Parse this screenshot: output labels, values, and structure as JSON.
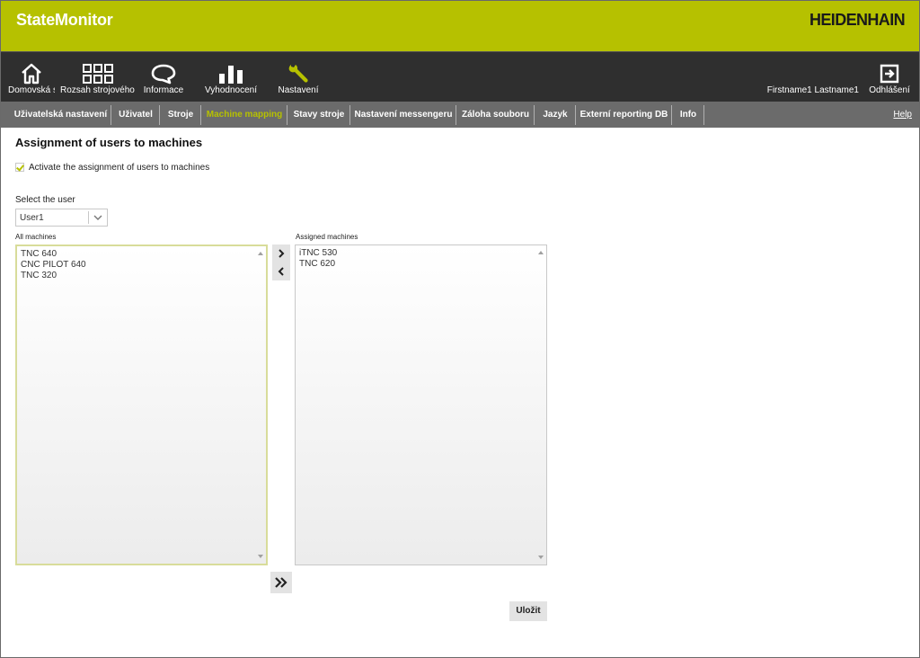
{
  "header": {
    "app_title": "StateMonitor",
    "brand": "HEIDENHAIN",
    "accent_color": "#b6c100"
  },
  "nav": {
    "items": [
      {
        "label": "Domovská s",
        "icon": "home-icon"
      },
      {
        "label": "Rozsah strojového p",
        "icon": "grid-icon"
      },
      {
        "label": "Informace",
        "icon": "chat-bubble-icon"
      },
      {
        "label": "Vyhodnocení",
        "icon": "bar-chart-icon"
      },
      {
        "label": "Nastavení",
        "icon": "wrench-icon"
      }
    ],
    "user_name": "Firstname1 Lastname1",
    "logout_label": "Odhlášení",
    "logout_icon": "logout-icon"
  },
  "subnav": {
    "items": [
      {
        "label": "Uživatelská nastavení"
      },
      {
        "label": "Uživatel"
      },
      {
        "label": "Stroje"
      },
      {
        "label": "Machine mapping",
        "active": true
      },
      {
        "label": "Stavy stroje"
      },
      {
        "label": "Nastavení messengeru"
      },
      {
        "label": "Záloha souboru"
      },
      {
        "label": "Jazyk"
      },
      {
        "label": "Externí reporting DB"
      },
      {
        "label": "Info"
      }
    ],
    "help_label": "Help"
  },
  "main": {
    "title": "Assignment of users to machines",
    "activate_label": "Activate the assignment of users to machines",
    "activate_checked": true,
    "select_user_label": "Select the user",
    "selected_user": "User1",
    "all_machines_label": "All machines",
    "all_machines": [
      "TNC 640",
      "CNC PILOT 640",
      "TNC 320"
    ],
    "assigned_machines_label": "Assigned machines",
    "assigned_machines": [
      "iTNC 530",
      "TNC 620"
    ],
    "move_right_symbol": ">",
    "move_left_symbol": "<",
    "move_all_symbol": "»",
    "save_label": "Uložit"
  }
}
